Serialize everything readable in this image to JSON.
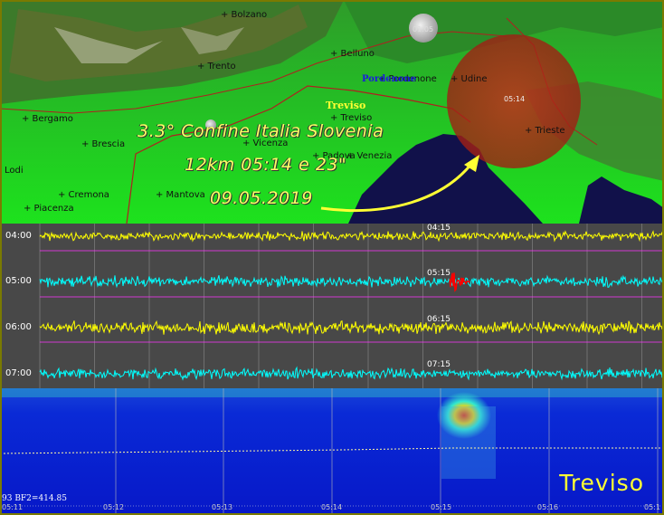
{
  "map": {
    "cities": [
      {
        "id": "bolzano",
        "label": "+ Bolzano"
      },
      {
        "id": "trento",
        "label": "+ Trento"
      },
      {
        "id": "belluno",
        "label": "+ Belluno"
      },
      {
        "id": "pordenone",
        "label": "+ Pordenone"
      },
      {
        "id": "udine",
        "label": "+ Udine"
      },
      {
        "id": "treviso-city",
        "label": "+ Treviso"
      },
      {
        "id": "bergamo",
        "label": "+ Bergamo"
      },
      {
        "id": "brescia",
        "label": "+ Brescia"
      },
      {
        "id": "vicenza",
        "label": "+ Vicenza"
      },
      {
        "id": "padova",
        "label": "+ Padova"
      },
      {
        "id": "venezia",
        "label": "+ Venezia"
      },
      {
        "id": "trieste",
        "label": "+ Trieste"
      },
      {
        "id": "lodi",
        "label": "Lodi"
      },
      {
        "id": "cremona",
        "label": "+ Cremona"
      },
      {
        "id": "mantova",
        "label": "+ Mantova"
      },
      {
        "id": "piacenza",
        "label": "+ Piacenza"
      }
    ],
    "station_label": "Treviso",
    "pordenone_label": "Pordenone",
    "headline": [
      "3.3° Confine Italia Slovenia",
      "12km 05:14 e 23\"",
      "09.05.2019"
    ],
    "moon_label": "01:05",
    "epicenter_time": "05:14",
    "colors": {
      "land": "#1aa81a",
      "sea": "#11114a",
      "epicenter": "#b3261a",
      "text": "#ffff66"
    }
  },
  "helicorder": {
    "rows": [
      {
        "time": "04:00",
        "tick": "04:15",
        "color": "#ffff00"
      },
      {
        "time": "05:00",
        "tick": "05:15",
        "color": "#00ffff"
      },
      {
        "time": "06:00",
        "tick": "06:15",
        "color": "#ffff00"
      },
      {
        "time": "07:00",
        "tick": "07:15",
        "color": "#00ffff"
      }
    ],
    "event_color": "#ff0000"
  },
  "spectrogram": {
    "x_labels": [
      "05:11",
      "05:12",
      "05:13",
      "05:14",
      "05:15",
      "05:16",
      "05:1"
    ],
    "footer": "93 BF2=414.85",
    "station": "Treviso"
  }
}
